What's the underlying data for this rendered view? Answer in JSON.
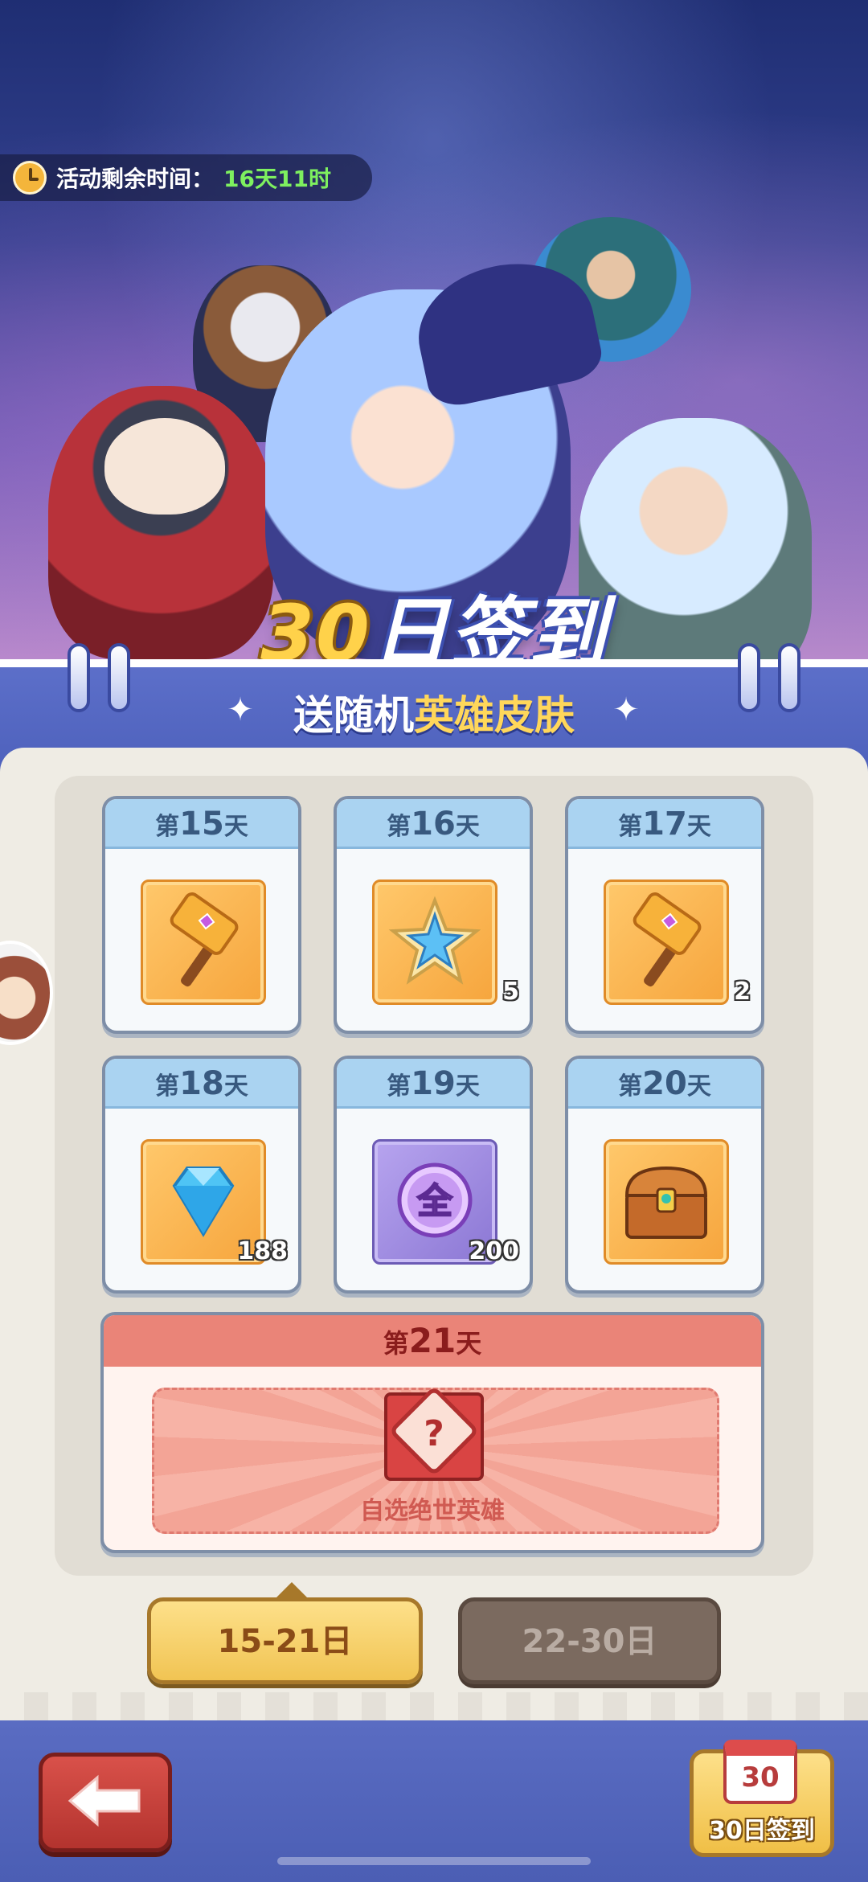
{
  "event": {
    "timer_label": "活动剩余时间：",
    "timer_value": "16天11时"
  },
  "banner": {
    "title_num": "30",
    "title_text": "日签到",
    "subtitle_prefix": "送随机",
    "subtitle_highlight": "英雄皮肤"
  },
  "days": [
    {
      "prefix": "第",
      "num": "15",
      "suffix": "天",
      "icon": "hammer-icon",
      "count": ""
    },
    {
      "prefix": "第",
      "num": "16",
      "suffix": "天",
      "icon": "snowflake-star-icon",
      "count": "5"
    },
    {
      "prefix": "第",
      "num": "17",
      "suffix": "天",
      "icon": "hammer-icon",
      "count": "2"
    },
    {
      "prefix": "第",
      "num": "18",
      "suffix": "天",
      "icon": "diamond-icon",
      "count": "188"
    },
    {
      "prefix": "第",
      "num": "19",
      "suffix": "天",
      "icon": "orb-icon",
      "orb_char": "全",
      "count": "200"
    },
    {
      "prefix": "第",
      "num": "20",
      "suffix": "天",
      "icon": "treasure-chest-icon",
      "count": ""
    }
  ],
  "day21": {
    "prefix": "第",
    "num": "21",
    "suffix": "天",
    "icon": "mystery-box-icon",
    "q": "?",
    "label": "自选绝世英雄"
  },
  "tabs": [
    {
      "label": "15-21日",
      "active": true
    },
    {
      "label": "22-30日",
      "active": false
    }
  ],
  "bottom": {
    "sign_cal_num": "30",
    "sign_label": "30日签到"
  },
  "colors": {
    "accent_green": "#7ef05f",
    "banner_blue": "#4f62bd",
    "gold": "#f1c453",
    "day21_red": "#ea8478"
  }
}
